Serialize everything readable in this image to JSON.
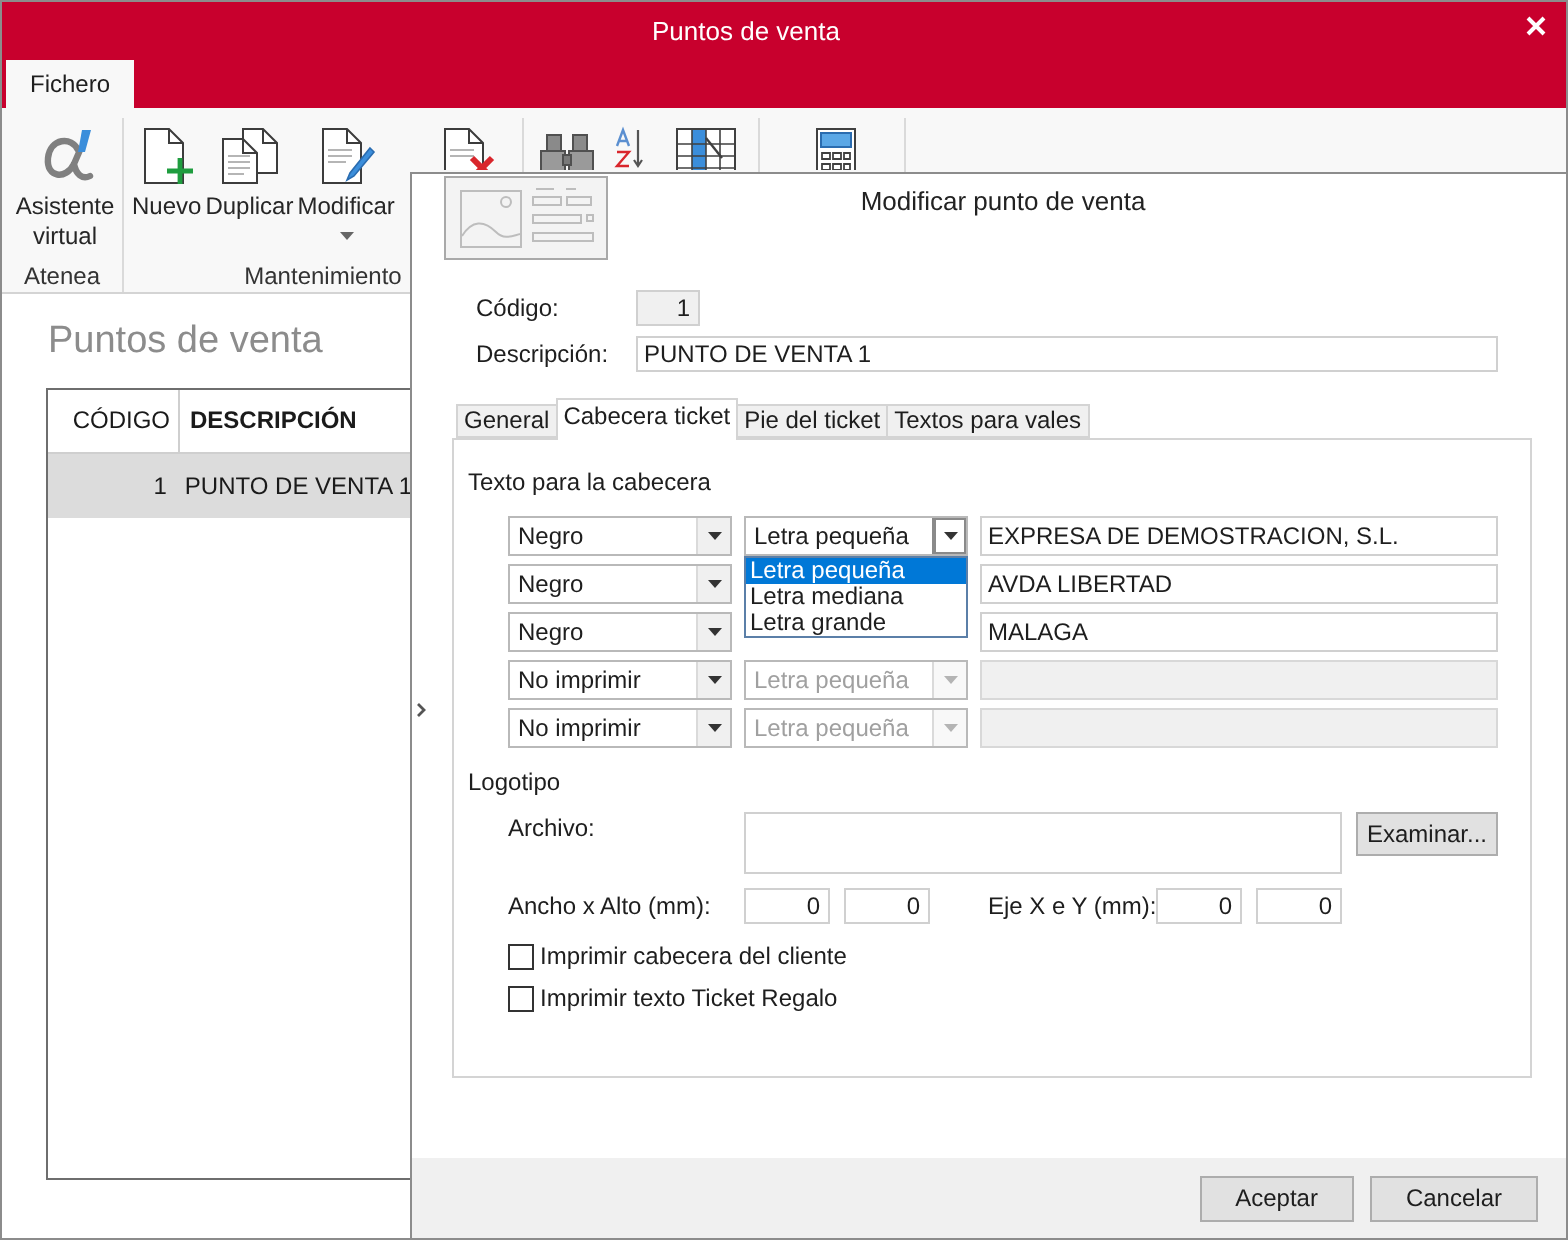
{
  "window": {
    "title": "Puntos de venta"
  },
  "ribbon": {
    "tabs": [
      {
        "label": "Fichero",
        "selected": true
      }
    ],
    "groups": [
      {
        "label": "Atenea",
        "buttons": [
          {
            "kind": "assistant",
            "label": "Asistente virtual",
            "menu": false
          }
        ]
      },
      {
        "label": "Mantenimiento",
        "buttons": [
          {
            "kind": "new",
            "label": "Nuevo",
            "menu": false
          },
          {
            "kind": "duplicate",
            "label": "Duplicar",
            "menu": false
          },
          {
            "kind": "edit",
            "label": "Modificar",
            "menu": true
          },
          {
            "kind": "delete"
          }
        ]
      },
      {
        "buttons": [
          {
            "kind": "find"
          },
          {
            "kind": "sort"
          },
          {
            "kind": "columns"
          }
        ]
      },
      {
        "buttons": [
          {
            "kind": "calculator"
          }
        ]
      }
    ]
  },
  "list": {
    "title": "Puntos de venta",
    "columns": [
      {
        "label": "CÓDIGO",
        "sorted": false
      },
      {
        "label": "DESCRIPCIÓN",
        "sorted": true
      }
    ],
    "rows": [
      {
        "cells": [
          "1",
          "PUNTO DE VENTA 1"
        ],
        "selected": true
      }
    ]
  },
  "dialog": {
    "title": "Modificar punto de venta",
    "fields": [
      {
        "kind": "readonly",
        "label": "Código:",
        "value": "1"
      },
      {
        "kind": "text",
        "label": "Descripción:",
        "value": "PUNTO DE VENTA 1"
      }
    ],
    "tabs": [
      {
        "label": "General",
        "selected": false
      },
      {
        "label": "Cabecera ticket",
        "selected": true
      },
      {
        "label": "Pie del ticket",
        "selected": false
      },
      {
        "label": "Textos para vales",
        "selected": false
      }
    ],
    "header_text": {
      "title": "Texto para la cabecera",
      "lines": [
        {
          "ink": "Negro",
          "size": "Letra pequeña",
          "expanded": true,
          "size_options": [
            {
              "label": "Letra pequeña",
              "selected": true
            },
            {
              "label": "Letra mediana",
              "selected": false
            },
            {
              "label": "Letra grande",
              "selected": false
            }
          ],
          "text": "EXPRESA DE DEMOSTRACION, S.L.",
          "disabled": false
        },
        {
          "ink": "Negro",
          "text": "AVDA LIBERTAD",
          "disabled": false
        },
        {
          "ink": "Negro",
          "text": "MALAGA",
          "disabled": false
        },
        {
          "ink": "No imprimir",
          "size": "Letra pequeña",
          "expanded": false,
          "disabled": true
        },
        {
          "ink": "No imprimir",
          "size": "Letra pequeña",
          "expanded": false,
          "disabled": true
        }
      ]
    },
    "logo": {
      "title": "Logotipo",
      "file_label": "Archivo:",
      "browse_button": "Examinar...",
      "size_label": "Ancho x Alto (mm):",
      "size_values": [
        "0",
        "0"
      ],
      "offset_label": "Eje X e Y (mm):",
      "offset_values": [
        "0",
        "0"
      ]
    },
    "options": [
      {
        "label": "Imprimir cabecera del cliente",
        "checked": false
      },
      {
        "label": "Imprimir texto Ticket Regalo",
        "checked": false
      }
    ],
    "buttons": [
      "Aceptar",
      "Cancelar"
    ]
  }
}
